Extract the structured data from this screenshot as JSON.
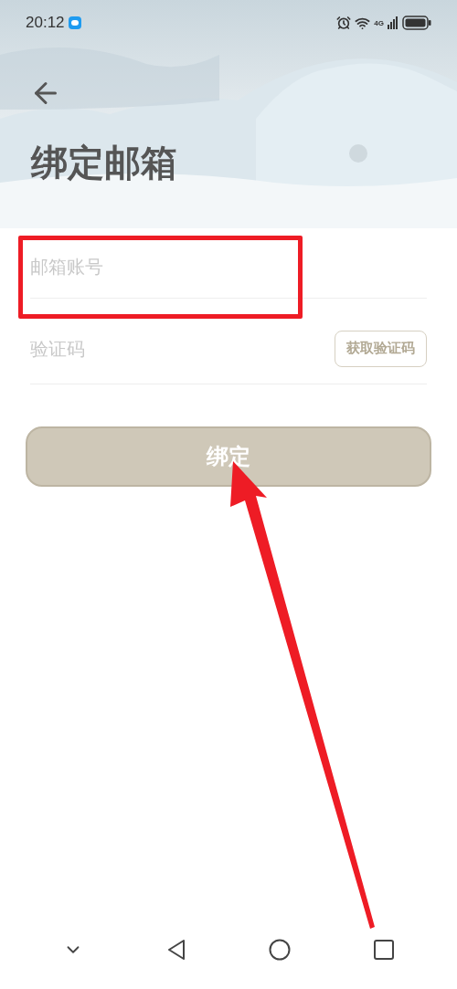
{
  "status_bar": {
    "time": "20:12",
    "network": "4G"
  },
  "title": "绑定邮箱",
  "fields": [
    {
      "kind": "email",
      "placeholder": "邮箱账号"
    },
    {
      "kind": "code",
      "placeholder": "验证码",
      "button": "获取验证码"
    }
  ],
  "submit": "绑定"
}
